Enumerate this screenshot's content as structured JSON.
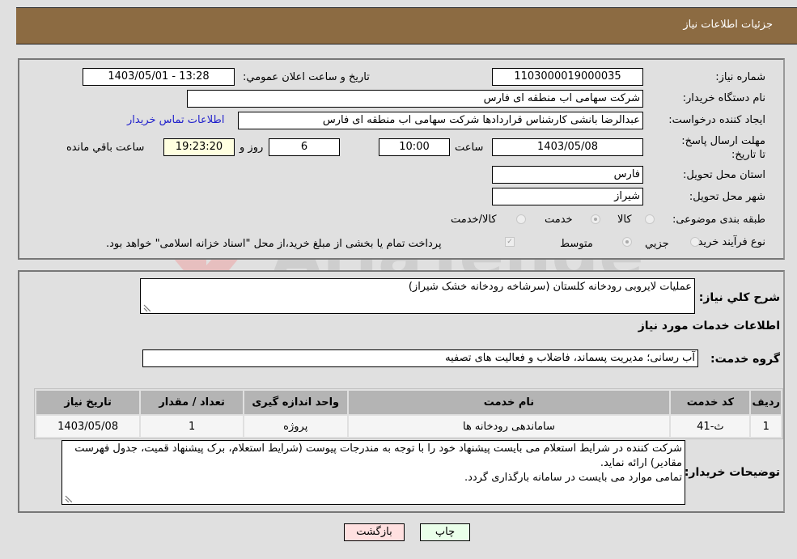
{
  "header": {
    "title": "جزئیات اطلاعات نیاز"
  },
  "form": {
    "need_number_label": "شماره نیاز:",
    "need_number": "1103000019000035",
    "announce_label": "تاریخ و ساعت اعلان عمومي:",
    "announce_value": "1403/05/01 - 13:28",
    "buyer_org_label": "نام دستگاه خريدار:",
    "buyer_org": "شرکت سهامی اب منطقه ای فارس",
    "creator_label": "ايجاد کننده درخواست:",
    "creator": "عبدالرضا بانشی کارشناس قراردادها شرکت سهامی اب منطقه ای فارس",
    "contact_link": "اطلاعات تماس خريدار",
    "deadline_label": "مهلت ارسال پاسخ: تا تاریخ:",
    "deadline_date": "1403/05/08",
    "time_label": "ساعت",
    "deadline_time": "10:00",
    "days": "6",
    "days_label": "روز و",
    "remaining_time": "19:23:20",
    "remaining_label": "ساعت باقي مانده",
    "province_label": "استان محل تحويل:",
    "province": "فارس",
    "city_label": "شهر محل تحويل:",
    "city": "شیراز",
    "category_label": "طبقه بندی موضوعی:",
    "category_options": [
      {
        "label": "کالا",
        "selected": false
      },
      {
        "label": "خدمت",
        "selected": true
      },
      {
        "label": "کالا/خدمت",
        "selected": false
      }
    ],
    "purchase_type_label": "نوع فرآیند خرید :",
    "purchase_type_options": [
      {
        "label": "جزيي",
        "selected": false
      },
      {
        "label": "متوسط",
        "selected": true
      }
    ],
    "treasury_checkbox_checked": true,
    "treasury_note": "پرداخت تمام يا بخشی از مبلغ خريد،از محل \"اسناد خزانه اسلامی\" خواهد بود."
  },
  "details": {
    "description_label": "شرح کلي نياز:",
    "description": "عملیات لایروبی رودخانه کلستان (سرشاخه رودخانه خشک شیراز)",
    "services_heading": "اطلاعات خدمات مورد نياز",
    "service_group_label": "گروه خدمت:",
    "service_group": "آب رسانی؛ مدیریت پسماند، فاضلاب و فعالیت های تصفیه",
    "table": {
      "headers": [
        "رديف",
        "کد خدمت",
        "نام خدمت",
        "واحد اندازه گيری",
        "تعداد / مقدار",
        "تاريخ نياز"
      ],
      "rows": [
        [
          "1",
          "ث-41",
          "ساماندهی رودخانه ها",
          "پروژه",
          "1",
          "1403/05/08"
        ]
      ]
    },
    "buyer_notes_label": "توضيحات خريدار:",
    "buyer_notes_lines": [
      "شرکت کننده در شرایط استعلام می بایست پیشنهاد خود را با توجه به مندرجات پیوست (شرایط استعلام، برک پیشنهاد قمیت، جدول فهرست مقادیر) ارائه نماید.",
      "تمامی موارد می بایست در سامانه بارگذاری گردد."
    ]
  },
  "buttons": {
    "print": "چاپ",
    "back": "بازگشت"
  },
  "colors": {
    "header_bg": "#8c6b42",
    "print_bg": "#eaffea",
    "back_bg": "#ffe0e0",
    "link": "#2222cc"
  }
}
